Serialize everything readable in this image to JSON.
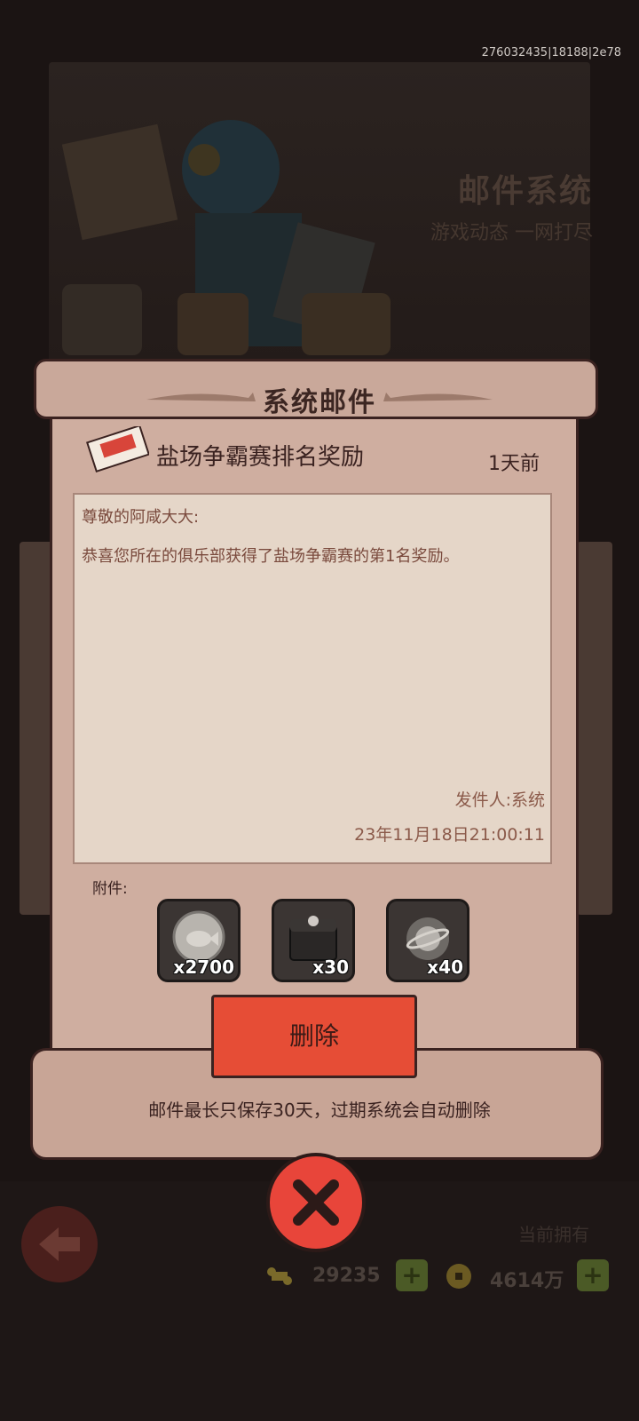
{
  "build_id": "276032435|18188|2e78",
  "banner": {
    "title": "邮件系统",
    "subtitle": "游戏动态 一网打尽"
  },
  "dialog": {
    "title": "系统邮件",
    "subject": "盐场争霸赛排名奖励",
    "time": "1天前",
    "greeting": "尊敬的阿咸大大:",
    "body": "恭喜您所在的俱乐部获得了盐场争霸赛的第1名奖励。",
    "sender": "发件人:系统",
    "date": "23年11月18日21:00:11",
    "attachments_label": "附件:",
    "attachments": [
      {
        "icon": "fish-coin-icon",
        "qty": "x2700"
      },
      {
        "icon": "treasure-chest-icon",
        "qty": "x30"
      },
      {
        "icon": "planet-orb-icon",
        "qty": "x40"
      }
    ],
    "delete_label": "删除",
    "expiry_note": "邮件最长只保存30天，过期系统会自动删除"
  },
  "footer": {
    "owned_label": "当前拥有",
    "currency_1": "29235",
    "currency_2": "4614万",
    "plus_symbol": "+"
  },
  "colors": {
    "accent": "#e64d36",
    "paper": "#cfaea0",
    "ink": "#3a2220",
    "letter_text": "#7a4a3d"
  }
}
